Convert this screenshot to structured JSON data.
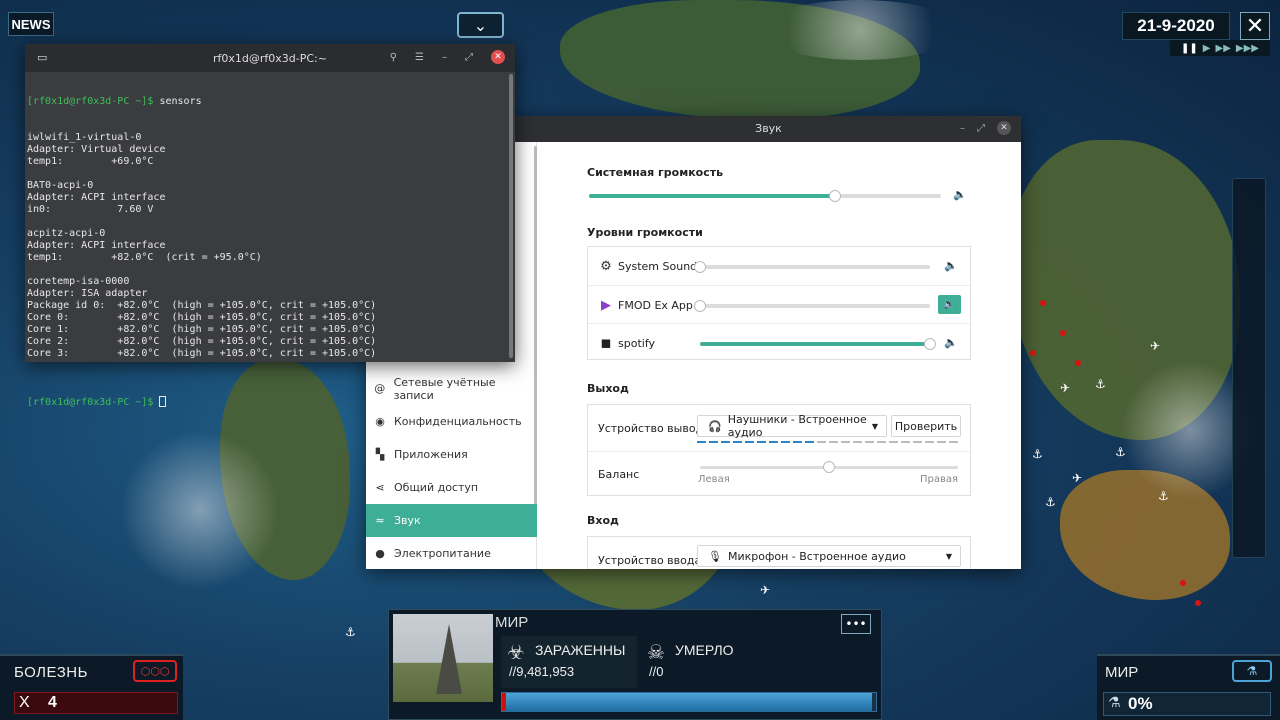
{
  "game": {
    "news_label": "NEWS",
    "date": "21-9-2020",
    "disease": {
      "title": "БОЛЕЗНЬ",
      "bar_label": "X",
      "dna_points": "4"
    },
    "world": {
      "title": "МИР",
      "infected_label": "ЗАРАЖЕННЫ",
      "infected_value": "//9,481,953",
      "dead_label": "УМЕРЛО",
      "dead_value": "//0",
      "infection_fraction": 0.99
    },
    "mir": {
      "title": "МИР",
      "cure_value": "0%"
    },
    "colors": {
      "accent_blue": "#4da3d6",
      "danger_red": "#d11111"
    }
  },
  "terminal": {
    "title": "rf0x1d@rf0x3d-PC:~",
    "prompt": "[rf0x1d@rf0x3d-PC ~]$",
    "command": "sensors",
    "lines": [
      "iwlwifi_1-virtual-0",
      "Adapter: Virtual device",
      "temp1:        +69.0°C",
      "",
      "BAT0-acpi-0",
      "Adapter: ACPI interface",
      "in0:           7.60 V",
      "",
      "acpitz-acpi-0",
      "Adapter: ACPI interface",
      "temp1:        +82.0°C  (crit = +95.0°C)",
      "",
      "coretemp-isa-0000",
      "Adapter: ISA adapter",
      "Package id 0:  +82.0°C  (high = +105.0°C, crit = +105.0°C)",
      "Core 0:        +82.0°C  (high = +105.0°C, crit = +105.0°C)",
      "Core 1:        +82.0°C  (high = +105.0°C, crit = +105.0°C)",
      "Core 2:        +82.0°C  (high = +105.0°C, crit = +105.0°C)",
      "Core 3:        +82.0°C  (high = +105.0°C, crit = +105.0°C)",
      ""
    ],
    "prompt_color": "#3fbf5a"
  },
  "sound": {
    "window_title": "Звук",
    "sidebar": [
      {
        "label": "Сетевые учётные записи",
        "icon": "at-icon"
      },
      {
        "label": "Конфиденциальность",
        "icon": "privacy-icon"
      },
      {
        "label": "Приложения",
        "icon": "apps-icon"
      },
      {
        "label": "Общий доступ",
        "icon": "share-icon"
      },
      {
        "label": "Звук",
        "icon": "sound-icon",
        "active": true
      },
      {
        "label": "Электропитание",
        "icon": "power-icon"
      }
    ],
    "system_volume": {
      "title": "Системная громкость",
      "level": 0.7
    },
    "app_levels": {
      "title": "Уровни громкости",
      "apps": [
        {
          "name": "System Sounds",
          "icon": "gear-icon",
          "level": 0.0,
          "speaker_active": false
        },
        {
          "name": "FMOD Ex App",
          "icon": "fmod-icon",
          "level": 0.0,
          "speaker_active": true
        },
        {
          "name": "spotify",
          "icon": "spotify-icon",
          "level": 1.0,
          "speaker_active": false
        }
      ]
    },
    "output": {
      "title": "Выход",
      "device_label": "Устройство вывода",
      "device_value": "Наушники - Встроенное аудио",
      "test_button": "Проверить",
      "output_level": 0.45,
      "balance_label": "Баланс",
      "balance_left": "Левая",
      "balance_right": "Правая",
      "balance": 0.5
    },
    "input": {
      "title": "Вход",
      "device_label": "Устройство ввода",
      "device_value": "Микрофон - Встроенное аудио"
    },
    "accent_color": "#3fae97"
  }
}
